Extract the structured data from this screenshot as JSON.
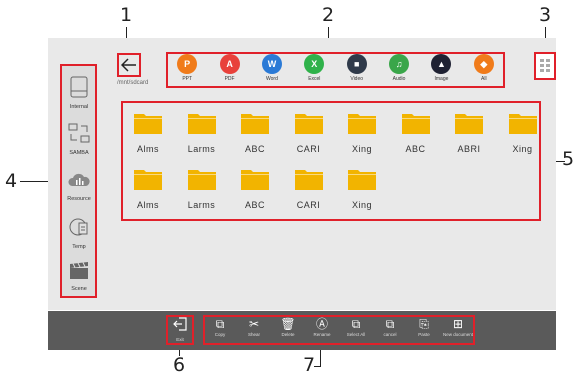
{
  "callouts": [
    "1",
    "2",
    "3",
    "4",
    "5",
    "6",
    "7"
  ],
  "path": "/mnt/sdcard",
  "sidebar": {
    "items": [
      {
        "label": "Internal",
        "icon": "drive-icon"
      },
      {
        "label": "SAMBA",
        "icon": "network-share-icon"
      },
      {
        "label": "Resource",
        "icon": "cloud-icon"
      },
      {
        "label": "Temp",
        "icon": "temp-file-icon"
      },
      {
        "label": "Scene",
        "icon": "clapperboard-icon"
      }
    ]
  },
  "types": [
    {
      "label": "PPT",
      "color": "#f07b1a",
      "glyph": "P"
    },
    {
      "label": "PDF",
      "color": "#e8413b",
      "glyph": "A"
    },
    {
      "label": "Word",
      "color": "#2b7ad6",
      "glyph": "W"
    },
    {
      "label": "Excel",
      "color": "#2fb24a",
      "glyph": "X"
    },
    {
      "label": "Video",
      "color": "#2f3a4a",
      "glyph": "■"
    },
    {
      "label": "Audio",
      "color": "#3aa64a",
      "glyph": "♫"
    },
    {
      "label": "Image",
      "color": "#1f2233",
      "glyph": "▲"
    },
    {
      "label": "All",
      "color": "#f07b1a",
      "glyph": "◆"
    }
  ],
  "files": [
    "Alms",
    "Larms",
    "ABC",
    "CARI",
    "Xing",
    "ABC",
    "ABRI",
    "Xing",
    "Alms",
    "Larms",
    "ABC",
    "CARI",
    "Xing"
  ],
  "folder_color": "#f2b400",
  "exit_label": "Exit",
  "tools": [
    {
      "label": "Copy",
      "glyph": "⧉"
    },
    {
      "label": "Shear",
      "glyph": "✂"
    },
    {
      "label": "Delete",
      "glyph": "🗑"
    },
    {
      "label": "Rename",
      "glyph": "Ⓐ"
    },
    {
      "label": "Select All",
      "glyph": "⧉"
    },
    {
      "label": "cancel",
      "glyph": "⧉"
    },
    {
      "label": "Paste",
      "glyph": "⎘"
    },
    {
      "label": "New document",
      "glyph": "⊞"
    }
  ],
  "accent_red": "#e0202a"
}
